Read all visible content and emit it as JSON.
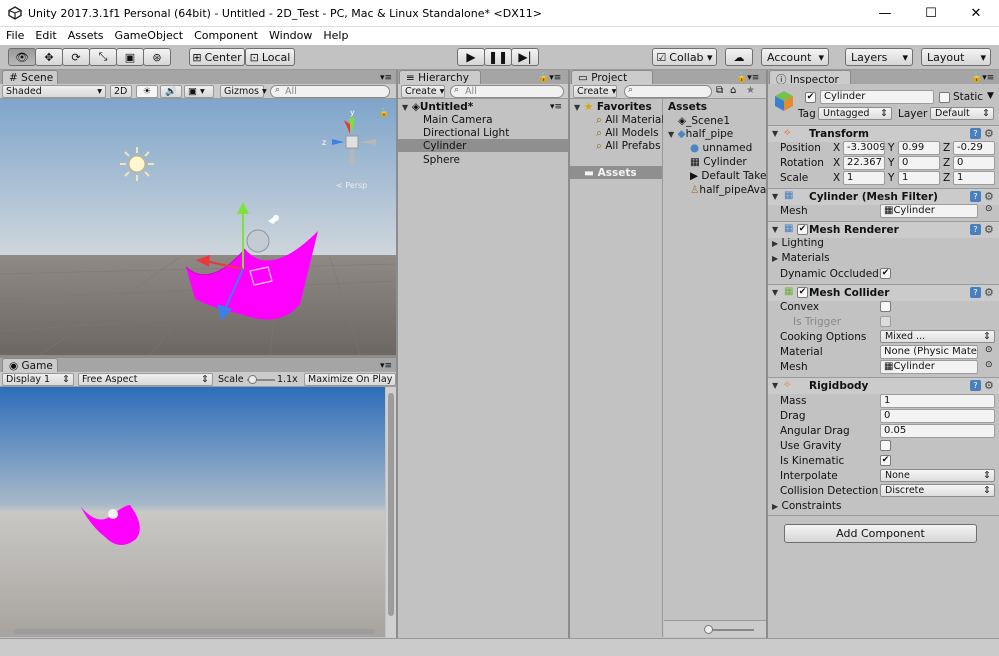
{
  "window": {
    "title": "Unity 2017.3.1f1 Personal (64bit) - Untitled - 2D_Test - PC, Mac & Linux Standalone* <DX11>",
    "min": "—",
    "max": "☐",
    "close": "✕"
  },
  "menu": [
    "File",
    "Edit",
    "Assets",
    "GameObject",
    "Component",
    "Window",
    "Help"
  ],
  "toolbar": {
    "center": "Center",
    "local": "Local",
    "collab": "Collab ▾",
    "account": "Account",
    "layers": "Layers",
    "layout": "Layout"
  },
  "scene": {
    "tab": "Scene",
    "shading": "Shaded",
    "mode2d": "2D",
    "gizmos": "Gizmos",
    "search": "All",
    "persp": "< Persp"
  },
  "game": {
    "tab": "Game",
    "display": "Display 1",
    "aspect": "Free Aspect",
    "scale_label": "Scale",
    "scale_value": "1.1x",
    "maximize": "Maximize On Play"
  },
  "hierarchy": {
    "tab": "Hierarchy",
    "create": "Create ▾",
    "search": "All",
    "root": "Untitled*",
    "items": [
      "Main Camera",
      "Directional Light",
      "Cylinder",
      "Sphere"
    ]
  },
  "project": {
    "tab": "Project",
    "create": "Create ▾",
    "favorites": "Favorites",
    "fav_items": [
      "All Materials",
      "All Models",
      "All Prefabs"
    ],
    "assets_folder": "Assets",
    "assets_header": "Assets",
    "tree": [
      "_Scene1",
      "half_pipe",
      "unnamed",
      "Cylinder",
      "Default Take",
      "half_pipeAvatar"
    ]
  },
  "inspector": {
    "tab": "Inspector",
    "object_name": "Cylinder",
    "static": "Static",
    "tag_label": "Tag",
    "tag_value": "Untagged",
    "layer_label": "Layer",
    "layer_value": "Default",
    "transform": {
      "title": "Transform",
      "position": {
        "label": "Position",
        "x": "-3.3009",
        "y": "0.99",
        "z": "-0.29"
      },
      "rotation": {
        "label": "Rotation",
        "x": "22.367",
        "y": "0",
        "z": "0"
      },
      "scale": {
        "label": "Scale",
        "x": "1",
        "y": "1",
        "z": "1"
      }
    },
    "mesh_filter": {
      "title": "Cylinder (Mesh Filter)",
      "mesh_label": "Mesh",
      "mesh_value": "Cylinder"
    },
    "mesh_renderer": {
      "title": "Mesh Renderer",
      "lighting": "Lighting",
      "materials": "Materials",
      "dynamic": "Dynamic Occluded"
    },
    "mesh_collider": {
      "title": "Mesh Collider",
      "convex": "Convex",
      "trigger": "Is Trigger",
      "cooking": "Cooking Options",
      "cooking_value": "Mixed ...",
      "material": "Material",
      "material_value": "None (Physic Material)",
      "mesh": "Mesh",
      "mesh_value": "Cylinder"
    },
    "rigidbody": {
      "title": "Rigidbody",
      "mass": "Mass",
      "mass_value": "1",
      "drag": "Drag",
      "drag_value": "0",
      "angular": "Angular Drag",
      "angular_value": "0.05",
      "gravity": "Use Gravity",
      "kinematic": "Is Kinematic",
      "interpolate": "Interpolate",
      "interpolate_value": "None",
      "collision": "Collision Detection",
      "collision_value": "Discrete",
      "constraints": "Constraints"
    },
    "add_component": "Add Component"
  },
  "colors": {
    "accent_magenta": "#ff00ff",
    "selection": "#8f8f8f",
    "panel": "#c2c2c2"
  }
}
